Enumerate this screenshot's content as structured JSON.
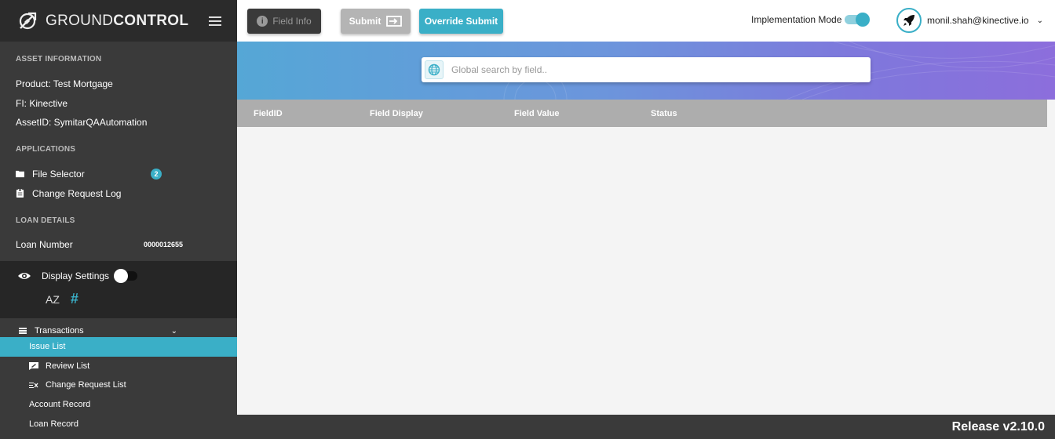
{
  "brand": {
    "name_light": "GROUND",
    "name_bold": "CONTROL"
  },
  "asset_info": {
    "title": "ASSET INFORMATION",
    "product": "Product:  Test Mortgage",
    "fi": "FI:  Kinective",
    "asset_id": "AssetID:  SymitarQAAutomation"
  },
  "applications": {
    "title": "APPLICATIONS",
    "items": [
      {
        "label": "File Selector",
        "badge": "2"
      },
      {
        "label": "Change Request Log"
      }
    ]
  },
  "loan_details": {
    "title": "LOAN DETAILS",
    "label": "Loan Number",
    "value": "0000012655"
  },
  "display_settings": {
    "label": "Display Settings",
    "sort_az": "AZ",
    "hash": "#"
  },
  "nav": {
    "header": "Transactions",
    "items": [
      {
        "label": "Issue List",
        "active": true
      },
      {
        "label": "Review List"
      },
      {
        "label": "Change Request List"
      },
      {
        "label": "Account Record"
      },
      {
        "label": "Loan Record"
      }
    ]
  },
  "toolbar": {
    "field_info": "Field Info",
    "submit": "Submit",
    "override_submit": "Override Submit",
    "implementation_mode": "Implementation Mode",
    "user_email": "monil.shah@kinective.io"
  },
  "search": {
    "placeholder": "Global search by field.."
  },
  "table": {
    "columns": [
      "FieldID",
      "Field Display",
      "Field Value",
      "Status"
    ]
  },
  "footer": {
    "release": "Release v2.10.0"
  },
  "colors": {
    "accent": "#3aafc7",
    "sidebar": "#3a3a3a",
    "sidebar_dark": "#262626"
  }
}
